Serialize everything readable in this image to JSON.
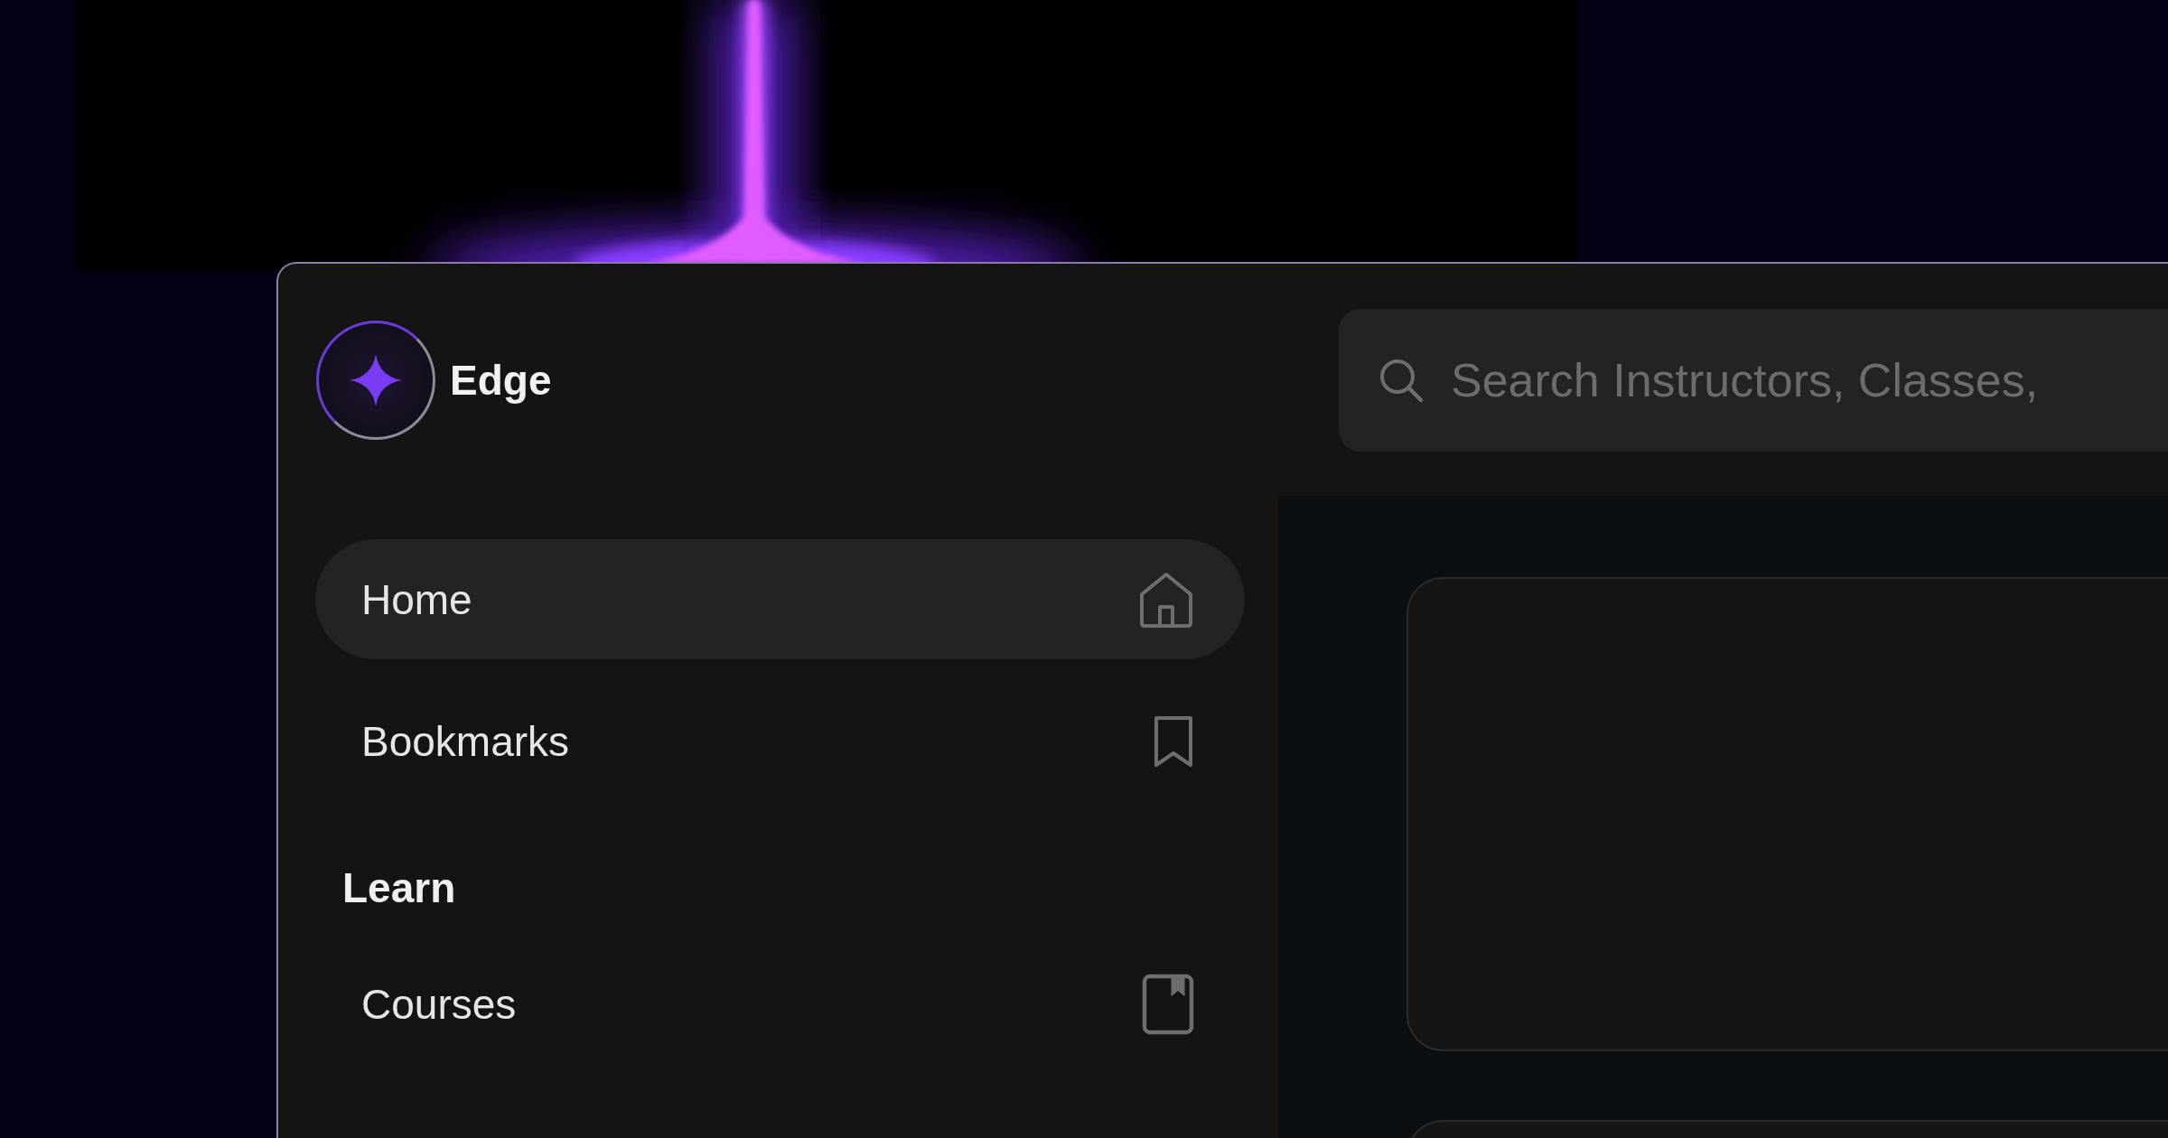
{
  "brand": {
    "name": "Edge"
  },
  "search": {
    "placeholder": "Search Instructors, Classes,"
  },
  "nav": [
    {
      "label": "Home",
      "kind": "home",
      "selected": true
    },
    {
      "label": "Bookmarks",
      "kind": "bookmark",
      "selected": false
    }
  ],
  "sections": [
    {
      "title": "Learn",
      "items": [
        {
          "label": "Courses",
          "kind": "book",
          "selected": false
        }
      ]
    }
  ]
}
